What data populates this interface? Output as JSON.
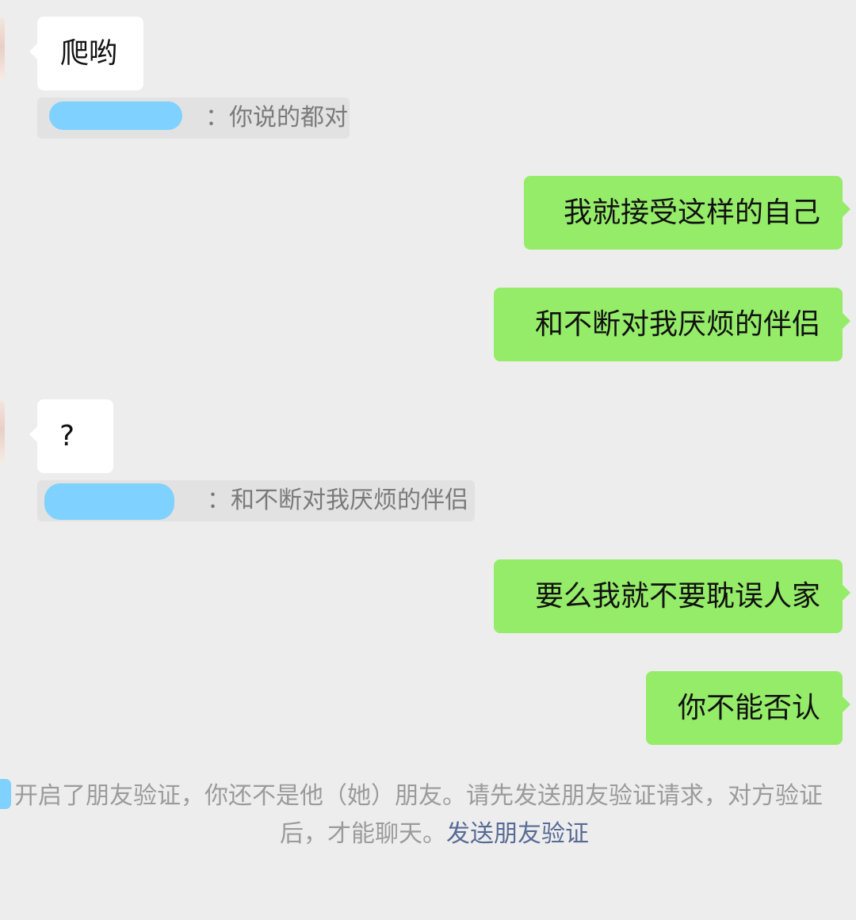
{
  "messages": [
    {
      "side": "left",
      "text": "爬哟"
    },
    {
      "quote_text": "你说的都对"
    },
    {
      "side": "right",
      "text": "我就接受这样的自己"
    },
    {
      "side": "right",
      "text": "和不断对我厌烦的伴侣"
    },
    {
      "side": "left",
      "text": "?"
    },
    {
      "quote_text": "和不断对我厌烦的伴侣"
    },
    {
      "side": "right",
      "text": "要么我就不要耽误人家"
    },
    {
      "side": "right",
      "text": "你不能否认"
    }
  ],
  "system_notice": {
    "line1": "开启了朋友验证，你还不是他（她）朋友。请先发送朋友验证请求，对方验证",
    "line2_prefix": "后，才能聊天。",
    "link": "发送朋友验证"
  },
  "colors": {
    "background": "#ededed",
    "sent_bubble": "#95ec69",
    "received_bubble": "#ffffff",
    "quote_bg": "#e2e2e2",
    "link": "#576b95"
  }
}
